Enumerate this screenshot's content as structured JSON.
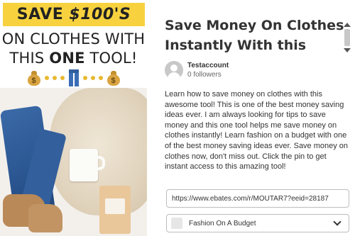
{
  "pin_image": {
    "banner_prefix": "SAVE ",
    "banner_amount": "$100'S",
    "headline_line1": "ON CLOTHES WITH",
    "headline_line2_pre": "THIS ",
    "headline_line2_strong": "ONE",
    "headline_line2_post": " TOOL!",
    "money_sign": "$",
    "banner_color": "#f7d23e"
  },
  "pin": {
    "title": "Save Money On Clothes\nInstantly With this",
    "author_name": "Testaccount",
    "author_followers": "0 followers",
    "description": "Learn how to save money on clothes with this awesome tool! This is one of the best money saving ideas ever. I am always looking for tips to save money and this one tool helps me save money on clothes instantly! Learn fashion on a budget with one of the best money saving ideas ever. Save money on clothes now, don't miss out. Click the pin to get instant access to this amazing tool!",
    "url_value": "https://www.ebates.com/r/MOUTAR7?eeid=28187",
    "board_selected": "Fashion On A Budget"
  },
  "icons": {
    "avatar": "default-user-avatar-icon",
    "board_dropdown": "chevron-down-icon",
    "moneybag": "money-bag-icon",
    "jeans": "jeans-icon"
  }
}
